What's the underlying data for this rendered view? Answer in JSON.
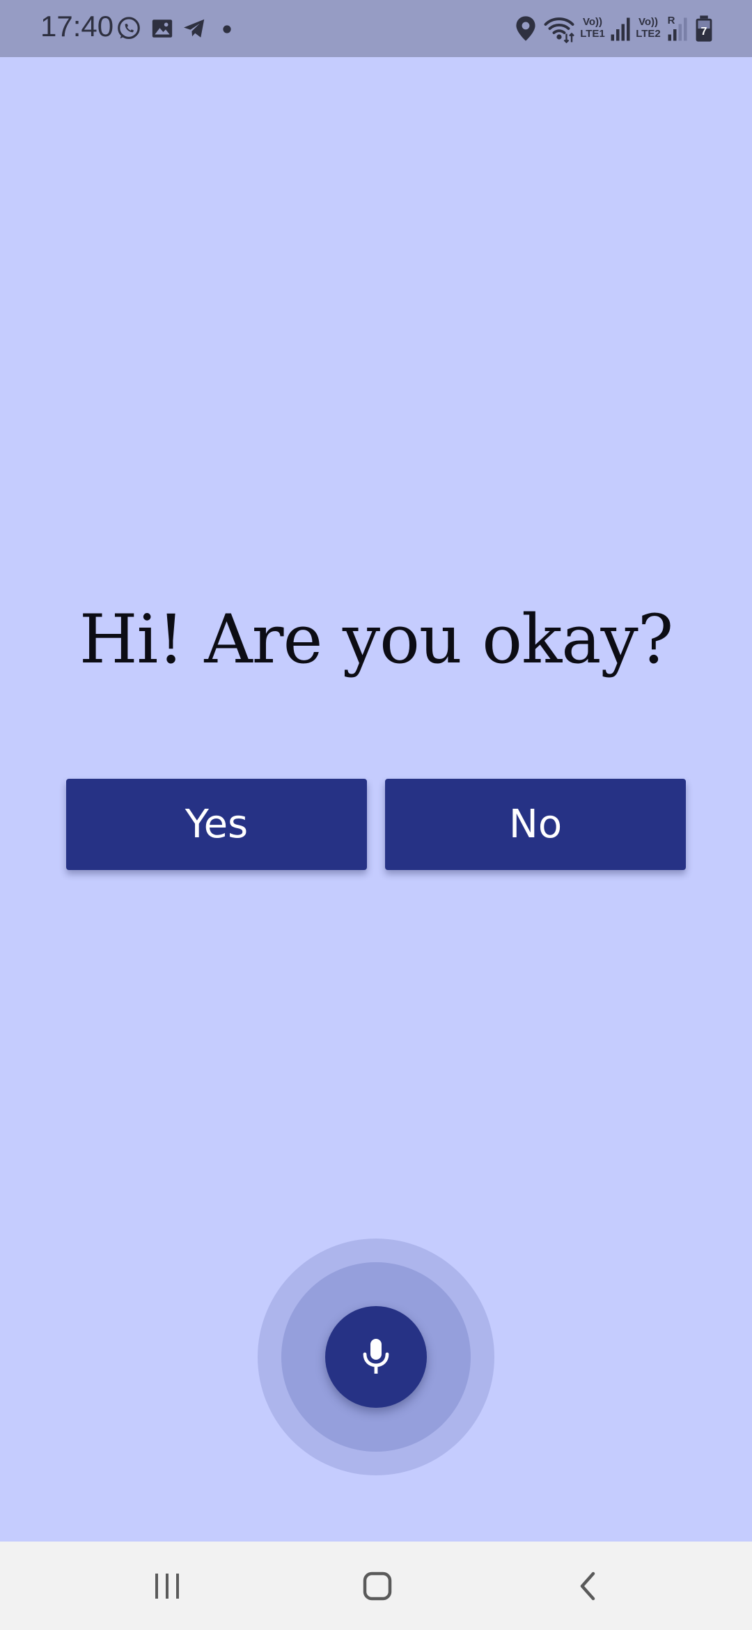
{
  "status_bar": {
    "time": "17:40",
    "notification_icons": [
      "whatsapp-icon",
      "gallery-icon",
      "telegram-icon",
      "more-dot-icon"
    ],
    "system_icons": [
      "location-icon",
      "wifi-icon",
      "signal-sim1-icon",
      "signal-sim2-icon",
      "battery-charging-icon"
    ],
    "sim1_label_top": "Vo))",
    "sim1_label_bottom": "LTE1",
    "sim2_label_top": "Vo))",
    "sim2_label_bottom": "LTE2",
    "roaming_label": "R",
    "battery_level": "7"
  },
  "main": {
    "question": "Hi! Are you okay?",
    "yes_label": "Yes",
    "no_label": "No",
    "mic_icon": "microphone-icon"
  },
  "colors": {
    "background": "#c5ccfe",
    "status_bar": "#969cc4",
    "primary": "#263285",
    "button_text": "#ffffff",
    "nav_bar": "#f2f2f2"
  },
  "nav_bar": {
    "buttons": [
      "recent-apps-icon",
      "home-icon",
      "back-icon"
    ]
  }
}
